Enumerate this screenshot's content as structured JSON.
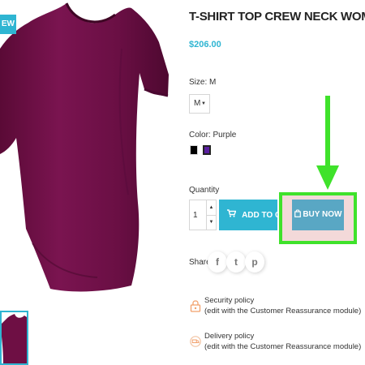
{
  "product": {
    "badge": "EW",
    "title": "T-SHIRT TOP CREW NECK WOMEN",
    "price": "$206.00",
    "size_label": "Size: M",
    "size_value": "M",
    "color_label": "Color: Purple",
    "swatches": [
      "black",
      "purple"
    ],
    "quantity_label": "Quantity",
    "quantity_value": "1",
    "add_to_cart_label": "ADD TO CAR",
    "buy_now_label": "BUY NOW",
    "share_label": "Share"
  },
  "social": {
    "facebook": "f",
    "twitter": "t",
    "pinterest": "p"
  },
  "reassurance": [
    {
      "title": "Security policy",
      "subtitle": "(edit with the Customer Reassurance module)",
      "icon": "lock-icon"
    },
    {
      "title": "Delivery policy",
      "subtitle": "(edit with the Customer Reassurance module)",
      "icon": "truck-icon"
    }
  ],
  "colors": {
    "accent": "#2fb5d2",
    "buy_now": "#59a7c4",
    "highlight": "#3fe22b",
    "shirt": "#6e0f44"
  }
}
